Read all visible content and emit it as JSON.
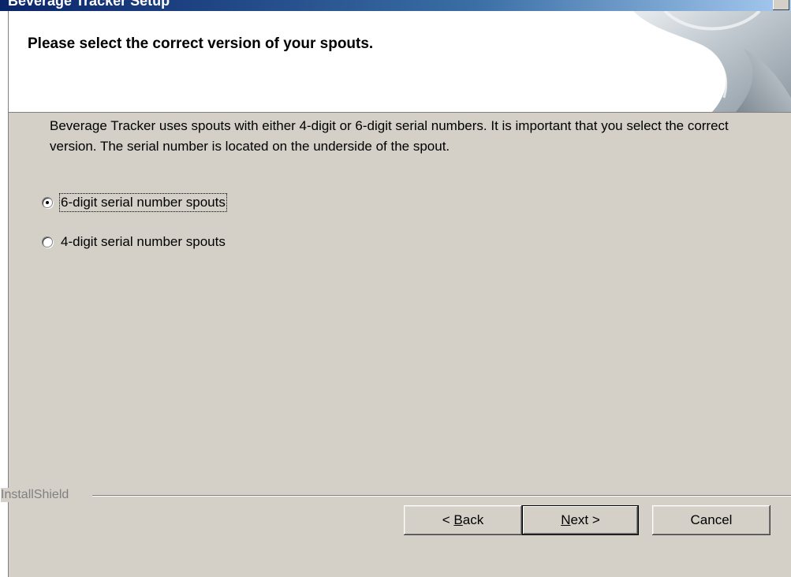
{
  "window": {
    "title": "Beverage Tracker Setup"
  },
  "header": {
    "title": "Please select the correct version of your spouts."
  },
  "body": {
    "description": "Beverage Tracker uses spouts with either 4-digit or 6-digit serial numbers. It is important that you select the correct version. The serial number is located on the underside of the spout.",
    "options": [
      {
        "label": "6-digit serial number spouts",
        "selected": true
      },
      {
        "label": "4-digit serial number spouts",
        "selected": false
      }
    ]
  },
  "footer": {
    "brand": "InstallShield",
    "back": {
      "prefix": "< ",
      "mnemonic": "B",
      "rest": "ack"
    },
    "next": {
      "mnemonic": "N",
      "rest": "ext >"
    },
    "cancel": "Cancel"
  }
}
